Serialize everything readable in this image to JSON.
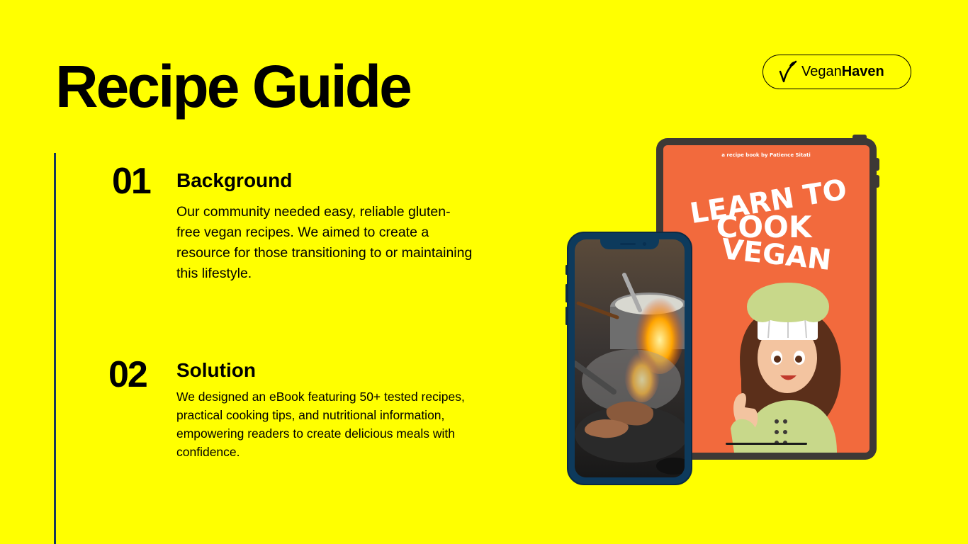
{
  "title": "Recipe Guide",
  "brand": {
    "name_regular": "Vegan",
    "name_bold": "Haven"
  },
  "sections": [
    {
      "number": "01",
      "heading": "Background",
      "body": "Our community needed easy, reliable gluten-free vegan recipes. We aimed to create a resource for those transitioning to or maintaining this lifestyle."
    },
    {
      "number": "02",
      "heading": "Solution",
      "body": "We designed an eBook featuring 50+ tested recipes, practical cooking tips, and nutritional information, empowering readers to create delicious meals with confidence."
    }
  ],
  "ebook_cover": {
    "byline": "a recipe book by Patience Sitati",
    "title_line1": "LEARN TO",
    "title_line2": "COOK",
    "title_line3": "VEGAN"
  },
  "colors": {
    "background": "#FFFF00",
    "accent_line": "#15395b",
    "cover": "#f26a3d",
    "tablet_frame": "#3d3936",
    "phone_frame": "#0d3a5c"
  },
  "icons": {
    "brand": "leaf-icon"
  }
}
